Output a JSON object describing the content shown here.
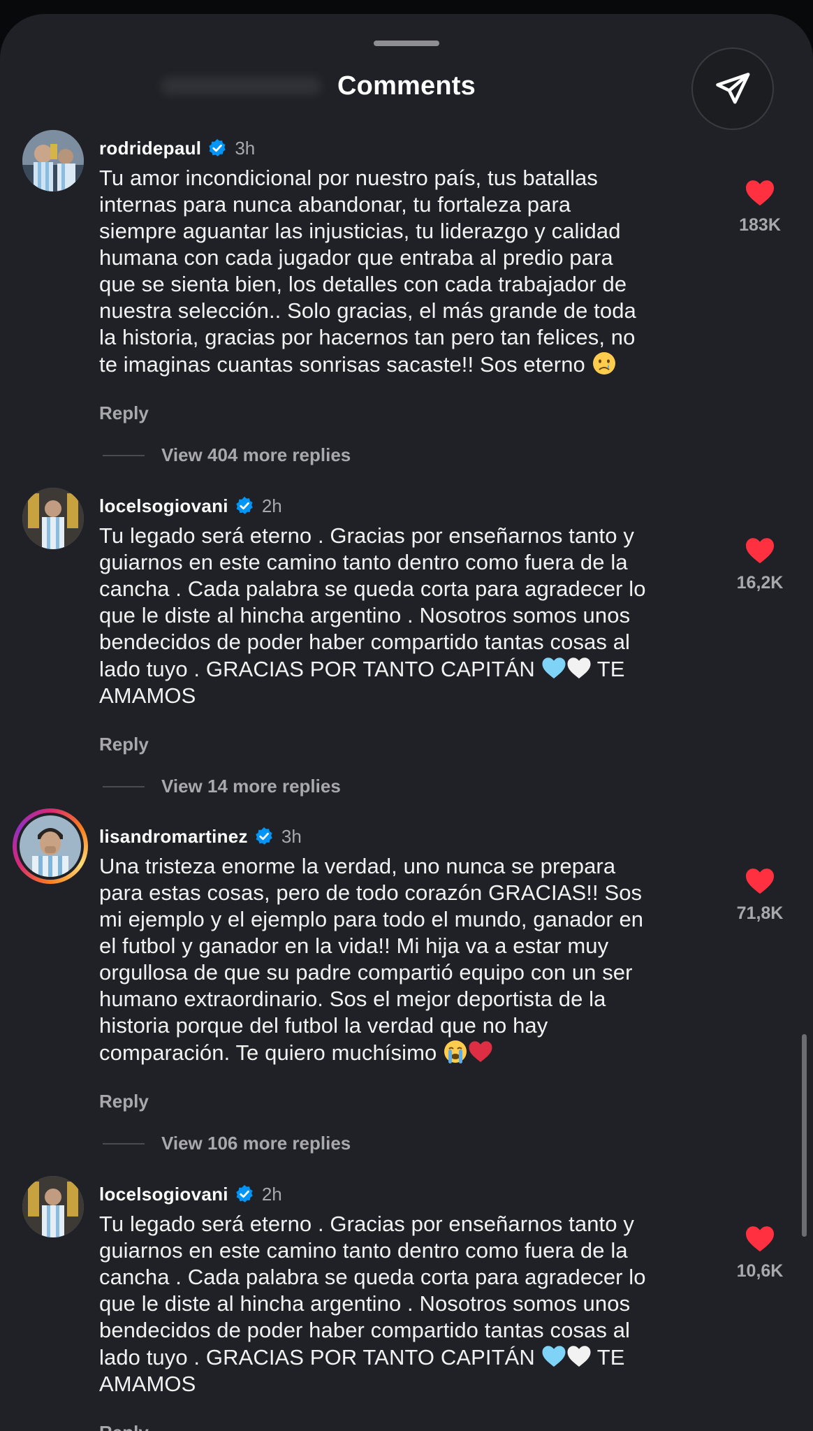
{
  "header": {
    "title": "Comments"
  },
  "comments": [
    {
      "username": "rodridepaul",
      "time": "3h",
      "lines": [
        "Tu amor incondicional por nuestro país, tus batallas",
        "internas para nunca abandonar, tu fortaleza para",
        "siempre aguantar las injusticias, tu liderazgo y calidad",
        "humana con cada jugador que entraba al predio para",
        "que se sienta bien, los detalles con cada trabajador de",
        "nuestra selección.. Solo gracias, el más grande de toda",
        "la historia, gracias por hacernos tan pero tan felices, no",
        "te imaginas cuantas sonrisas sacaste!! Sos eterno"
      ],
      "emoji_names": [
        "crying-face"
      ],
      "likes": "183K",
      "reply_label": "Reply",
      "view_replies": "View 404 more replies"
    },
    {
      "username": "locelsogiovani",
      "time": "2h",
      "lines": [
        "Tu legado será eterno . Gracias por enseñarnos tanto y",
        "guiarnos en este camino tanto dentro como fuera de la",
        "cancha . Cada palabra se queda corta para agradecer lo",
        "que le diste al hincha argentino . Nosotros somos unos",
        "bendecidos de poder haber compartido tantas cosas al",
        "lado tuyo .  GRACIAS POR TANTO CAPITÁN",
        "TE",
        "AMAMOS"
      ],
      "emoji_names": [
        "light-blue-heart",
        "white-heart"
      ],
      "likes": "16,2K",
      "reply_label": "Reply",
      "view_replies": "View 14 more replies"
    },
    {
      "username": "lisandromartinez",
      "time": "3h",
      "lines": [
        "Una tristeza enorme la verdad, uno nunca se prepara",
        "para estas cosas, pero de todo corazón GRACIAS!! Sos",
        "mi ejemplo y el ejemplo para todo el mundo, ganador en",
        "el futbol y ganador en la vida!! Mi hija va a estar muy",
        "orgullosa de que su padre compartió equipo con un ser",
        "humano extraordinario. Sos el mejor deportista de la",
        "historia porque del futbol la verdad que no hay",
        "comparación. Te quiero muchísimo"
      ],
      "emoji_names": [
        "loudly-crying-face",
        "red-heart"
      ],
      "likes": "71,8K",
      "reply_label": "Reply",
      "view_replies": "View 106 more replies"
    },
    {
      "username": "locelsogiovani",
      "time": "2h",
      "lines": [
        "Tu legado será eterno . Gracias por enseñarnos tanto y",
        "guiarnos en este camino tanto dentro como fuera de la",
        "cancha . Cada palabra se queda corta para agradecer lo",
        "que le diste al hincha argentino . Nosotros somos unos",
        "bendecidos de poder haber compartido tantas cosas al",
        "lado tuyo .  GRACIAS POR TANTO CAPITÁN",
        "TE",
        "AMAMOS"
      ],
      "emoji_names": [
        "light-blue-heart",
        "white-heart"
      ],
      "likes": "10,6K",
      "reply_label": "Reply"
    }
  ],
  "icons": {
    "send": "paper-plane-icon",
    "verified": "verified-badge-icon",
    "like": "heart-icon"
  },
  "colors": {
    "background": "#202126",
    "like_red": "#ff3040",
    "verified_blue": "#0095f6",
    "muted_text": "#a8a8ad"
  }
}
